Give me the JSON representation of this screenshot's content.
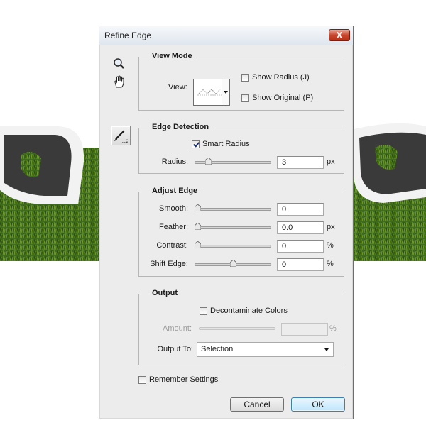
{
  "dialog": {
    "title": "Refine Edge",
    "close_label": "X"
  },
  "view_mode": {
    "title": "View Mode",
    "view_label": "View:",
    "show_radius_label": "Show Radius (J)",
    "show_radius_checked": false,
    "show_original_label": "Show Original (P)",
    "show_original_checked": false
  },
  "edge_detection": {
    "title": "Edge Detection",
    "smart_radius_label": "Smart Radius",
    "smart_radius_checked": true,
    "radius_label": "Radius:",
    "radius_value": "3",
    "radius_unit": "px",
    "radius_slider_fraction": 0.15
  },
  "adjust_edge": {
    "title": "Adjust Edge",
    "smooth": {
      "label": "Smooth:",
      "value": "0",
      "unit": "",
      "fraction": 0.0
    },
    "feather": {
      "label": "Feather:",
      "value": "0.0",
      "unit": "px",
      "fraction": 0.0
    },
    "contrast": {
      "label": "Contrast:",
      "value": "0",
      "unit": "%",
      "fraction": 0.0
    },
    "shift_edge": {
      "label": "Shift Edge:",
      "value": "0",
      "unit": "%",
      "fraction": 0.5
    }
  },
  "output": {
    "title": "Output",
    "decontaminate_label": "Decontaminate Colors",
    "decontaminate_checked": false,
    "amount_label": "Amount:",
    "amount_value": "",
    "amount_unit": "%",
    "output_to_label": "Output To:",
    "output_to_value": "Selection"
  },
  "remember_settings_label": "Remember Settings",
  "remember_settings_checked": false,
  "buttons": {
    "cancel": "Cancel",
    "ok": "OK"
  },
  "colors": {
    "grass": "#3f6b1c",
    "text_fill": "#3a3a3a",
    "text_outline": "#f2f2f2",
    "ok_border": "#3c7fb1"
  }
}
